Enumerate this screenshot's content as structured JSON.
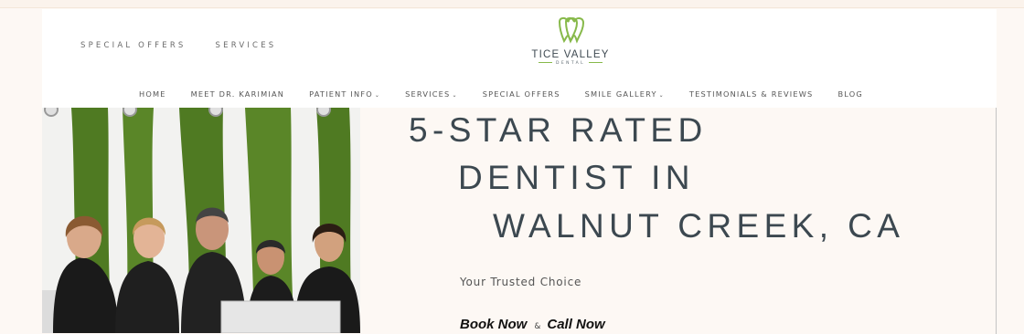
{
  "brand": {
    "name": "TICE VALLEY",
    "sub": "DENTAL",
    "accent": "#87b94a"
  },
  "utility_nav": [
    {
      "label": "SPECIAL OFFERS"
    },
    {
      "label": "SERVICES"
    }
  ],
  "main_nav": [
    {
      "label": "HOME",
      "dropdown": ""
    },
    {
      "label": "MEET DR. KARIMIAN",
      "dropdown": ""
    },
    {
      "label": "PATIENT INFO",
      "dropdown": "⌄"
    },
    {
      "label": "SERVICES",
      "dropdown": "⌄"
    },
    {
      "label": "SPECIAL OFFERS",
      "dropdown": ""
    },
    {
      "label": "SMILE GALLERY",
      "dropdown": "⌄"
    },
    {
      "label": "TESTIMONIALS & REVIEWS",
      "dropdown": ""
    },
    {
      "label": "BLOG",
      "dropdown": ""
    }
  ],
  "hero": {
    "line1": "5-STAR RATED",
    "line2": "DENTIST IN",
    "line3": "WALNUT CREEK, CA",
    "tagline": "Your Trusted Choice",
    "cta_book": "Book Now",
    "cta_amp": "&",
    "cta_call": "Call Now"
  },
  "colors": {
    "heading": "#3c4850",
    "moss": "#4f7a22",
    "page_bg": "#fdf8f4"
  }
}
